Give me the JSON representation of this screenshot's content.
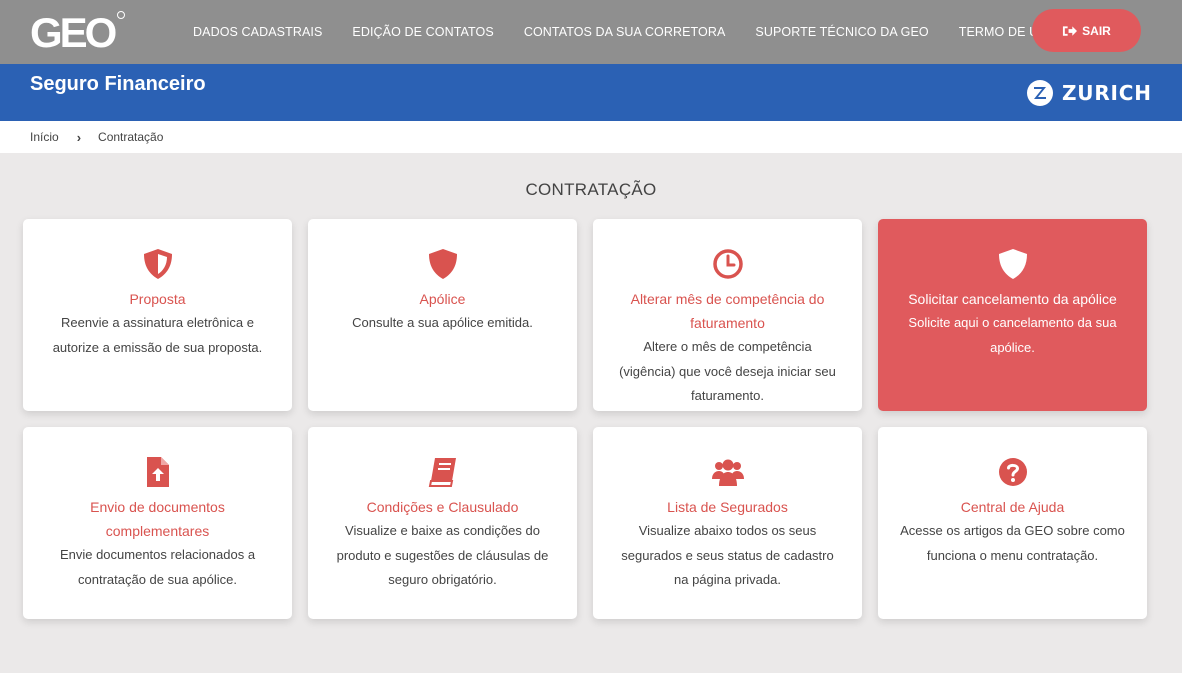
{
  "header": {
    "logo_text": "GEO",
    "nav": [
      "DADOS CADASTRAIS",
      "EDIÇÃO DE CONTATOS",
      "CONTATOS DA SUA CORRETORA",
      "SUPORTE TÉCNICO DA GEO",
      "TERMO DE USO"
    ],
    "exit_label": "SAIR"
  },
  "banner": {
    "title": "Seguro Financeiro",
    "brand": "ZURICH"
  },
  "breadcrumb": {
    "home": "Início",
    "current": "Contratação"
  },
  "section_title": "CONTRATAÇÃO",
  "cards": [
    {
      "icon": "shield-half-icon",
      "title": "Proposta",
      "desc": "Reenvie a assinatura eletrônica e autorize a emissão de sua proposta."
    },
    {
      "icon": "shield-icon",
      "title": "Apólice",
      "desc": "Consulte a sua apólice emitida."
    },
    {
      "icon": "clock-icon",
      "title": "Alterar mês de competência do faturamento",
      "desc": "Altere o mês de competência (vigência) que você deseja iniciar seu faturamento."
    },
    {
      "icon": "shield-icon",
      "title": "Solicitar cancelamento da apólice",
      "desc": "Solicite aqui o cancelamento da sua apólice."
    },
    {
      "icon": "file-upload-icon",
      "title": "Envio de documentos complementares",
      "desc": "Envie documentos relacionados a contratação de sua apólice."
    },
    {
      "icon": "book-icon",
      "title": "Condições e Clausulado",
      "desc": "Visualize e baixe as condições do produto e sugestões de cláusulas de seguro obrigatório."
    },
    {
      "icon": "users-icon",
      "title": "Lista de Segurados",
      "desc": "Visualize abaixo todos os seus segurados e seus status de cadastro na página privada."
    },
    {
      "icon": "question-circle-icon",
      "title": "Central de Ajuda",
      "desc": "Acesse os artigos da GEO sobre como funciona o menu contratação."
    }
  ],
  "colors": {
    "topbar": "#8f8f8f",
    "banner": "#2b61b4",
    "accent": "#e05a5d",
    "background": "#ebe9e9"
  }
}
